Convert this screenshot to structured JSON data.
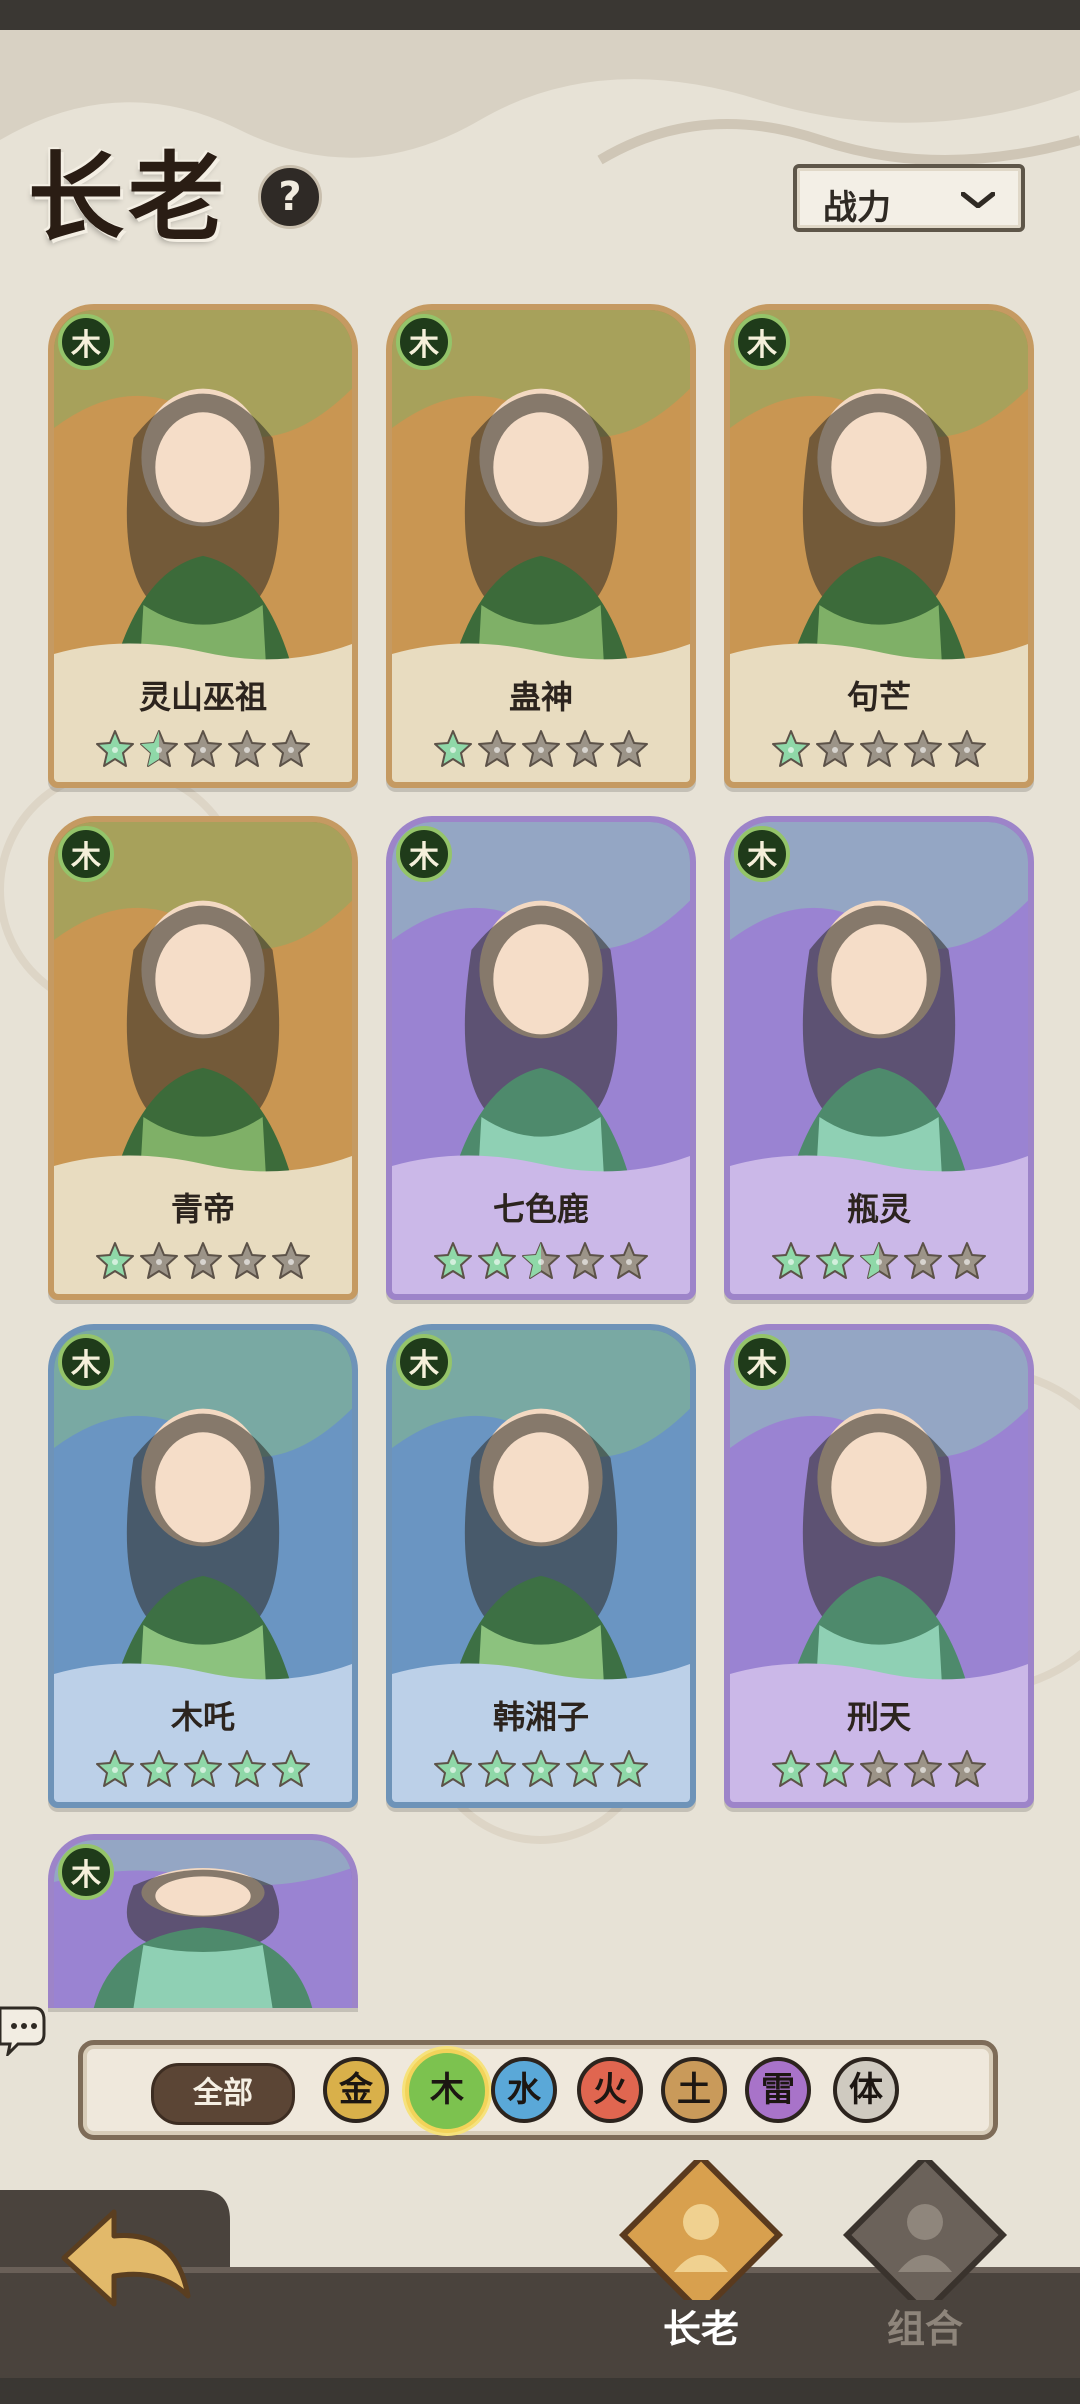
{
  "header": {
    "title": "长老",
    "help_label": "?",
    "sort": {
      "selected": "战力"
    }
  },
  "cards": [
    {
      "name": "灵山巫祖",
      "element": "木",
      "frame": "gold",
      "stars_lit": 1,
      "half": true,
      "stars_total": 5
    },
    {
      "name": "蛊神",
      "element": "木",
      "frame": "gold",
      "stars_lit": 1,
      "half": false,
      "stars_total": 5
    },
    {
      "name": "句芒",
      "element": "木",
      "frame": "gold",
      "stars_lit": 1,
      "half": false,
      "stars_total": 5
    },
    {
      "name": "青帝",
      "element": "木",
      "frame": "gold",
      "stars_lit": 1,
      "half": false,
      "stars_total": 5
    },
    {
      "name": "七色鹿",
      "element": "木",
      "frame": "purple",
      "stars_lit": 2,
      "half": true,
      "stars_total": 5
    },
    {
      "name": "瓶灵",
      "element": "木",
      "frame": "purple",
      "stars_lit": 2,
      "half": true,
      "stars_total": 5
    },
    {
      "name": "木吒",
      "element": "木",
      "frame": "blue",
      "stars_lit": 5,
      "half": false,
      "stars_total": 5
    },
    {
      "name": "韩湘子",
      "element": "木",
      "frame": "blue",
      "stars_lit": 5,
      "half": false,
      "stars_total": 5
    },
    {
      "name": "刑天",
      "element": "木",
      "frame": "purple",
      "stars_lit": 2,
      "half": false,
      "stars_total": 5
    },
    {
      "name": "",
      "element": "木",
      "frame": "purple",
      "partial": true
    }
  ],
  "filters": {
    "all_label": "全部",
    "elements": [
      {
        "label": "金",
        "color": "#d9b04a",
        "selected": false
      },
      {
        "label": "木",
        "color": "#7cc24f",
        "selected": true
      },
      {
        "label": "水",
        "color": "#5aa8d8",
        "selected": false
      },
      {
        "label": "火",
        "color": "#e06650",
        "selected": false
      },
      {
        "label": "土",
        "color": "#c99a5a",
        "selected": false
      },
      {
        "label": "雷",
        "color": "#a873c9",
        "selected": false
      },
      {
        "label": "体",
        "color": "#cfcac0",
        "selected": false
      }
    ]
  },
  "nav": {
    "tabs": [
      {
        "label": "长老",
        "active": true
      },
      {
        "label": "组合",
        "active": false
      }
    ]
  },
  "colors": {
    "star_lit": "#8fd8a8",
    "star_dim": "#9c9488",
    "accent_green": "#7cc24f"
  }
}
